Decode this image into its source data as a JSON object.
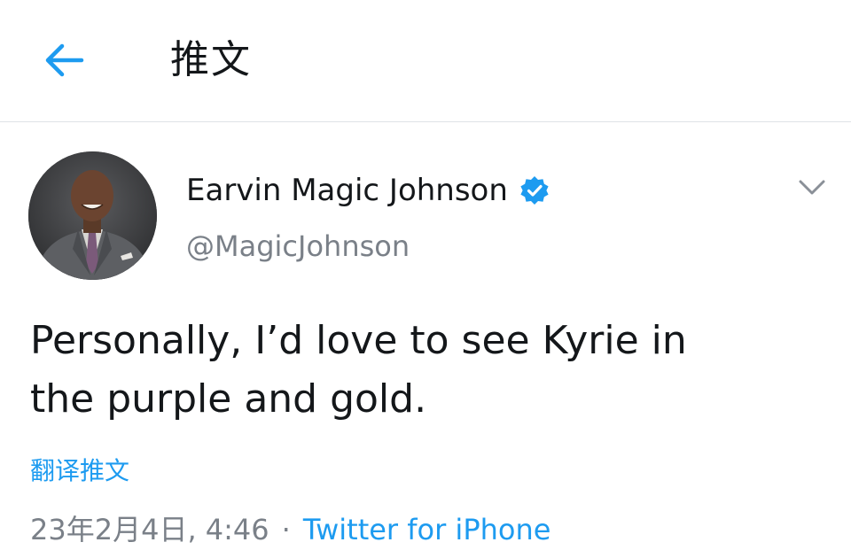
{
  "header": {
    "title": "推文",
    "back_icon": "arrow-left-icon"
  },
  "author": {
    "display_name": "Earvin Magic Johnson",
    "handle": "@MagicJohnson",
    "verified_icon": "verified-badge-icon",
    "menu_icon": "chevron-down-icon"
  },
  "tweet": {
    "text": "Personally, I’d love to see Kyrie in\nthe purple and gold.",
    "translate_label": "翻译推文",
    "timestamp": "23年2月4日, 4:46",
    "separator": "·",
    "source": "Twitter for iPhone"
  },
  "colors": {
    "accent": "#1d9bf0",
    "secondary_text": "#7a8088",
    "primary_text": "#14171a",
    "divider": "#dfe3e6"
  }
}
